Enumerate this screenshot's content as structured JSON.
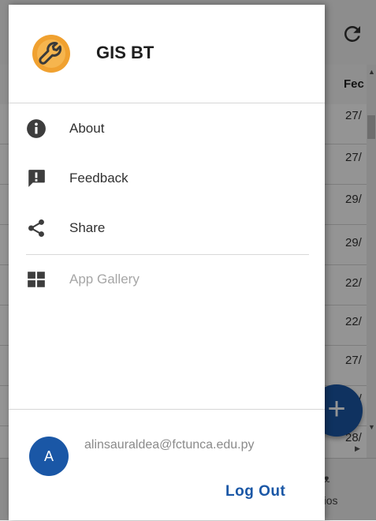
{
  "app": {
    "title": "GIS BT"
  },
  "drawer": {
    "menu": [
      {
        "label": "About",
        "icon": "info-icon"
      },
      {
        "label": "Feedback",
        "icon": "feedback-icon"
      },
      {
        "label": "Share",
        "icon": "share-icon"
      }
    ],
    "gallery": {
      "label": "App Gallery",
      "icon": "grid-icon"
    },
    "user": {
      "initial": "A",
      "email": "alinsauraldea@fctunca.edu.py"
    },
    "logout_label": "Log Out"
  },
  "background": {
    "column_header": "Fec",
    "rows": [
      "27/",
      "27/",
      "29/",
      "29/",
      "22/",
      "22/",
      "27/",
      "28/",
      "28/"
    ],
    "bottom_label": "rios",
    "fab_label": "+"
  },
  "colors": {
    "accent": "#1a57a6",
    "logo_orange": "#f0a130",
    "scrim": "rgba(0,0,0,0.42)"
  }
}
